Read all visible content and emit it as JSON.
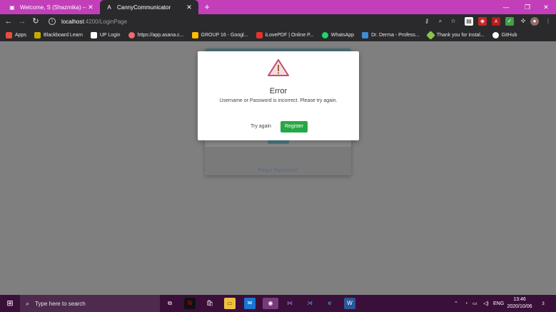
{
  "browser": {
    "tabs": [
      {
        "title": "Welcome, S (Shazmika) – Blackbo",
        "active": false,
        "icon": "blackboard-icon"
      },
      {
        "title": "CannyCommunicator",
        "active": true,
        "icon": "angular-icon"
      }
    ],
    "new_tab": "+",
    "address": {
      "host": "localhost",
      "path": ":4200/LoginPage"
    },
    "bookmarks": [
      {
        "label": "Apps",
        "icon": "apps-grid-icon",
        "color": "#e74c3c"
      },
      {
        "label": "Blackboard Learn",
        "icon": "blackboard-icon",
        "color": "#c8a800"
      },
      {
        "label": "UP Login",
        "icon": "up-icon",
        "color": "#ffffff"
      },
      {
        "label": "https://app.asana.c...",
        "icon": "asana-icon",
        "color": "#f06a6a"
      },
      {
        "label": "GROUP 16 - Googl...",
        "icon": "drive-icon",
        "color": "#fbbc04"
      },
      {
        "label": "iLovePDF | Online P...",
        "icon": "ilovepdf-icon",
        "color": "#e5322d"
      },
      {
        "label": "WhatsApp",
        "icon": "whatsapp-icon",
        "color": "#25d366"
      },
      {
        "label": "Dr. Derma - Profess...",
        "icon": "derma-icon",
        "color": "#3b8ed8"
      },
      {
        "label": "Thank you for instal...",
        "icon": "diamond-icon",
        "color": "#8bc34a"
      },
      {
        "label": "GitHub",
        "icon": "github-icon",
        "color": "#ffffff"
      }
    ]
  },
  "page": {
    "forgot_password": "Forgot Password?"
  },
  "modal": {
    "title": "Error",
    "message": "Username or Password is incorrect. Please try again.",
    "try_again": "Try again",
    "register": "Register",
    "warning_color": "#c0506a"
  },
  "taskbar": {
    "search_placeholder": "Type here to search",
    "language": "ENG",
    "time": "13:46",
    "date": "2020/10/06",
    "notification_count": "3"
  }
}
